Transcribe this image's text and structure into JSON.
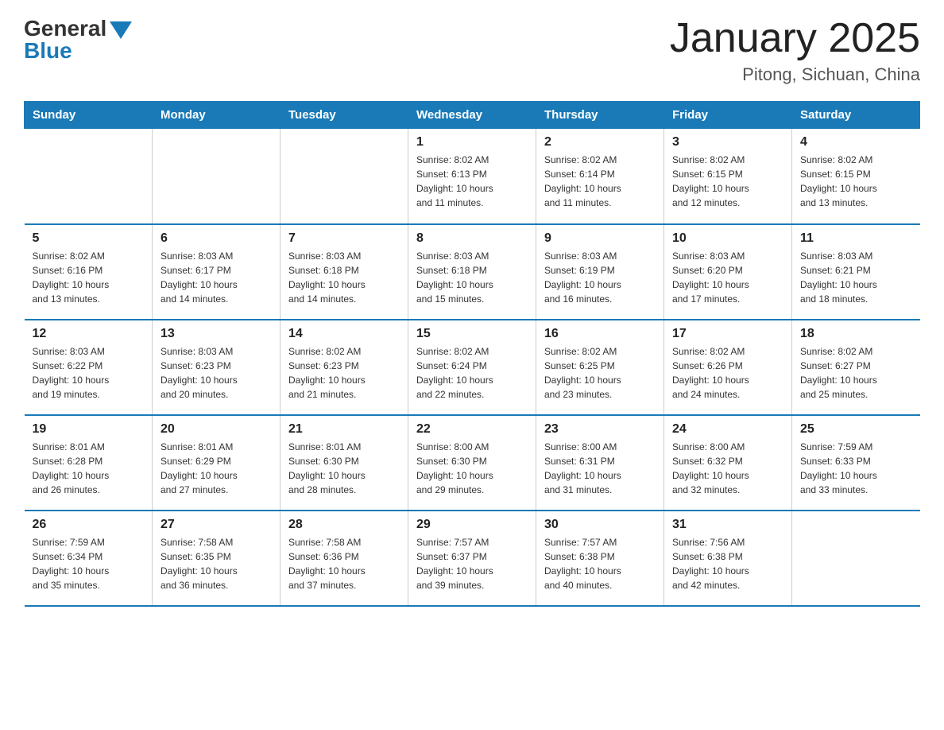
{
  "logo": {
    "general": "General",
    "blue": "Blue"
  },
  "header": {
    "title": "January 2025",
    "location": "Pitong, Sichuan, China"
  },
  "weekdays": [
    "Sunday",
    "Monday",
    "Tuesday",
    "Wednesday",
    "Thursday",
    "Friday",
    "Saturday"
  ],
  "weeks": [
    [
      {
        "day": "",
        "info": ""
      },
      {
        "day": "",
        "info": ""
      },
      {
        "day": "",
        "info": ""
      },
      {
        "day": "1",
        "info": "Sunrise: 8:02 AM\nSunset: 6:13 PM\nDaylight: 10 hours\nand 11 minutes."
      },
      {
        "day": "2",
        "info": "Sunrise: 8:02 AM\nSunset: 6:14 PM\nDaylight: 10 hours\nand 11 minutes."
      },
      {
        "day": "3",
        "info": "Sunrise: 8:02 AM\nSunset: 6:15 PM\nDaylight: 10 hours\nand 12 minutes."
      },
      {
        "day": "4",
        "info": "Sunrise: 8:02 AM\nSunset: 6:15 PM\nDaylight: 10 hours\nand 13 minutes."
      }
    ],
    [
      {
        "day": "5",
        "info": "Sunrise: 8:02 AM\nSunset: 6:16 PM\nDaylight: 10 hours\nand 13 minutes."
      },
      {
        "day": "6",
        "info": "Sunrise: 8:03 AM\nSunset: 6:17 PM\nDaylight: 10 hours\nand 14 minutes."
      },
      {
        "day": "7",
        "info": "Sunrise: 8:03 AM\nSunset: 6:18 PM\nDaylight: 10 hours\nand 14 minutes."
      },
      {
        "day": "8",
        "info": "Sunrise: 8:03 AM\nSunset: 6:18 PM\nDaylight: 10 hours\nand 15 minutes."
      },
      {
        "day": "9",
        "info": "Sunrise: 8:03 AM\nSunset: 6:19 PM\nDaylight: 10 hours\nand 16 minutes."
      },
      {
        "day": "10",
        "info": "Sunrise: 8:03 AM\nSunset: 6:20 PM\nDaylight: 10 hours\nand 17 minutes."
      },
      {
        "day": "11",
        "info": "Sunrise: 8:03 AM\nSunset: 6:21 PM\nDaylight: 10 hours\nand 18 minutes."
      }
    ],
    [
      {
        "day": "12",
        "info": "Sunrise: 8:03 AM\nSunset: 6:22 PM\nDaylight: 10 hours\nand 19 minutes."
      },
      {
        "day": "13",
        "info": "Sunrise: 8:03 AM\nSunset: 6:23 PM\nDaylight: 10 hours\nand 20 minutes."
      },
      {
        "day": "14",
        "info": "Sunrise: 8:02 AM\nSunset: 6:23 PM\nDaylight: 10 hours\nand 21 minutes."
      },
      {
        "day": "15",
        "info": "Sunrise: 8:02 AM\nSunset: 6:24 PM\nDaylight: 10 hours\nand 22 minutes."
      },
      {
        "day": "16",
        "info": "Sunrise: 8:02 AM\nSunset: 6:25 PM\nDaylight: 10 hours\nand 23 minutes."
      },
      {
        "day": "17",
        "info": "Sunrise: 8:02 AM\nSunset: 6:26 PM\nDaylight: 10 hours\nand 24 minutes."
      },
      {
        "day": "18",
        "info": "Sunrise: 8:02 AM\nSunset: 6:27 PM\nDaylight: 10 hours\nand 25 minutes."
      }
    ],
    [
      {
        "day": "19",
        "info": "Sunrise: 8:01 AM\nSunset: 6:28 PM\nDaylight: 10 hours\nand 26 minutes."
      },
      {
        "day": "20",
        "info": "Sunrise: 8:01 AM\nSunset: 6:29 PM\nDaylight: 10 hours\nand 27 minutes."
      },
      {
        "day": "21",
        "info": "Sunrise: 8:01 AM\nSunset: 6:30 PM\nDaylight: 10 hours\nand 28 minutes."
      },
      {
        "day": "22",
        "info": "Sunrise: 8:00 AM\nSunset: 6:30 PM\nDaylight: 10 hours\nand 29 minutes."
      },
      {
        "day": "23",
        "info": "Sunrise: 8:00 AM\nSunset: 6:31 PM\nDaylight: 10 hours\nand 31 minutes."
      },
      {
        "day": "24",
        "info": "Sunrise: 8:00 AM\nSunset: 6:32 PM\nDaylight: 10 hours\nand 32 minutes."
      },
      {
        "day": "25",
        "info": "Sunrise: 7:59 AM\nSunset: 6:33 PM\nDaylight: 10 hours\nand 33 minutes."
      }
    ],
    [
      {
        "day": "26",
        "info": "Sunrise: 7:59 AM\nSunset: 6:34 PM\nDaylight: 10 hours\nand 35 minutes."
      },
      {
        "day": "27",
        "info": "Sunrise: 7:58 AM\nSunset: 6:35 PM\nDaylight: 10 hours\nand 36 minutes."
      },
      {
        "day": "28",
        "info": "Sunrise: 7:58 AM\nSunset: 6:36 PM\nDaylight: 10 hours\nand 37 minutes."
      },
      {
        "day": "29",
        "info": "Sunrise: 7:57 AM\nSunset: 6:37 PM\nDaylight: 10 hours\nand 39 minutes."
      },
      {
        "day": "30",
        "info": "Sunrise: 7:57 AM\nSunset: 6:38 PM\nDaylight: 10 hours\nand 40 minutes."
      },
      {
        "day": "31",
        "info": "Sunrise: 7:56 AM\nSunset: 6:38 PM\nDaylight: 10 hours\nand 42 minutes."
      },
      {
        "day": "",
        "info": ""
      }
    ]
  ]
}
